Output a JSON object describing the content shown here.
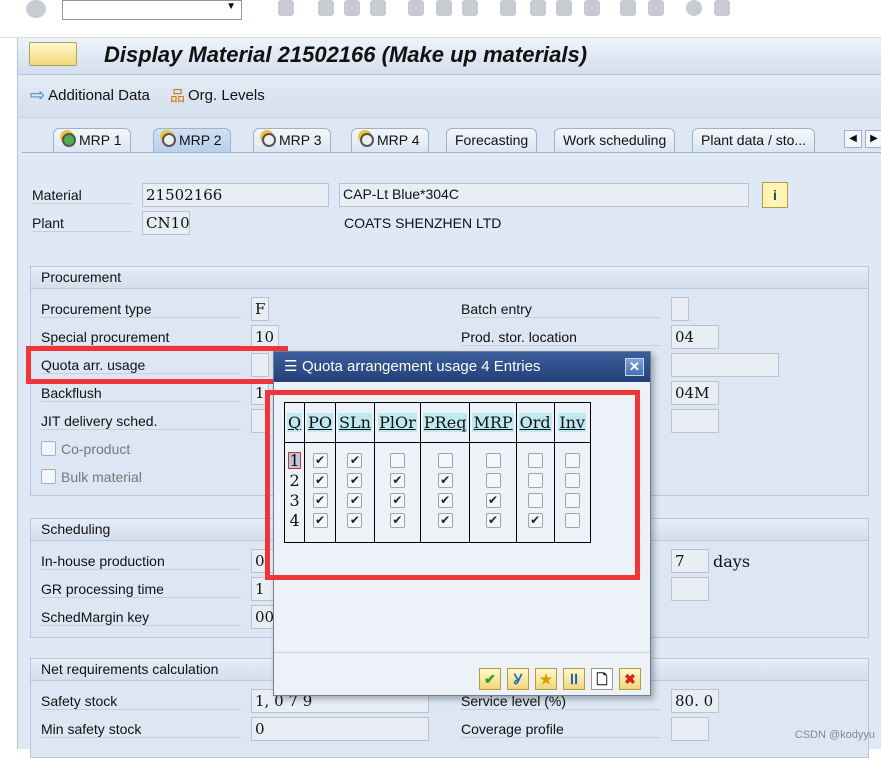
{
  "window": {
    "title": "Display Material 21502166 (Make up materials)"
  },
  "toolbar": {
    "additional_data": "Additional Data",
    "org_levels": "Org. Levels"
  },
  "tabs": [
    {
      "label": "MRP 1",
      "icon": "status-ok-icon"
    },
    {
      "label": "MRP 2",
      "icon": "mrp-icon",
      "active": true
    },
    {
      "label": "MRP 3",
      "icon": "mrp-icon"
    },
    {
      "label": "MRP 4",
      "icon": "mrp-icon"
    },
    {
      "label": "Forecasting"
    },
    {
      "label": "Work scheduling"
    },
    {
      "label": "Plant data / sto..."
    }
  ],
  "header": {
    "material_label": "Material",
    "material": "21502166",
    "material_desc": "CAP-Lt Blue*304C",
    "plant_label": "Plant",
    "plant": "CN10",
    "plant_desc": "COATS SHENZHEN LTD"
  },
  "procurement": {
    "title": "Procurement",
    "procurement_type_label": "Procurement type",
    "procurement_type": "F",
    "special_procurement_label": "Special procurement",
    "special_procurement": "10",
    "quota_label": "Quota arr. usage",
    "quota": "",
    "backflush_label": "Backflush",
    "backflush": "1",
    "jit_label": "JIT delivery sched.",
    "coproduct_label": "Co-product",
    "bulk_label": "Bulk material",
    "batch_entry_label": "Batch entry",
    "prod_stor_label": "Prod. stor. location",
    "prod_stor": "04",
    "field_04m": "04M"
  },
  "scheduling": {
    "title": "Scheduling",
    "inhouse_label": "In-house production",
    "inhouse": "0",
    "gr_label": "GR processing time",
    "gr": "1",
    "schedmargin_label": "SchedMargin key",
    "schedmargin": "00",
    "days_value": "7",
    "days_label": "days"
  },
  "netreq": {
    "title": "Net requirements calculation",
    "safety_stock_label": "Safety stock",
    "safety_stock": "1, 0 7 9",
    "service_level_label": "Service level (%)",
    "service_level": "80. 0",
    "min_safety_label": "Min safety stock",
    "min_safety": "0",
    "coverage_label": "Coverage profile"
  },
  "dialog": {
    "title": "Quota arrangement usage 4 Entries",
    "columns": [
      "Q",
      "PO",
      "SLn",
      "PlOr",
      "PReq",
      "MRP",
      "Ord",
      "Inv"
    ],
    "rows": [
      {
        "q": "1",
        "checks": [
          true,
          true,
          false,
          false,
          false,
          false,
          false
        ]
      },
      {
        "q": "2",
        "checks": [
          true,
          true,
          true,
          true,
          false,
          false,
          false
        ]
      },
      {
        "q": "3",
        "checks": [
          true,
          true,
          true,
          true,
          true,
          false,
          false
        ]
      },
      {
        "q": "4",
        "checks": [
          true,
          true,
          true,
          true,
          true,
          true,
          false
        ]
      }
    ]
  },
  "watermark": "CSDN @kodyyu",
  "colors": {
    "highlight": "#f0353a",
    "dialog_header": "#2c4a85"
  }
}
